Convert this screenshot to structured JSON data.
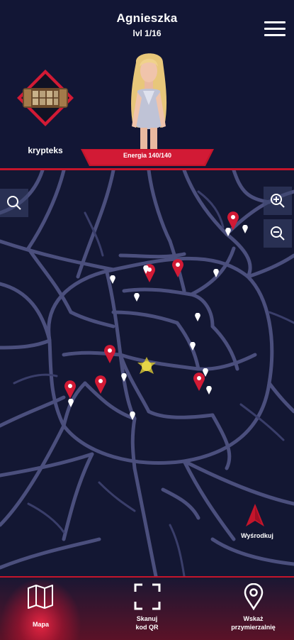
{
  "player": {
    "name": "Agnieszka",
    "level": "lvl 1/16",
    "energy": "Energia 140/140"
  },
  "item": {
    "label": "krypteks"
  },
  "map": {
    "center_label": "Wyśrodkuj"
  },
  "bottom_nav": {
    "items": [
      {
        "label": "Mapa",
        "icon": "map-icon",
        "active": true
      },
      {
        "label_line1": "Skanuj",
        "label_line2": "kod QR",
        "icon": "qr-scan-icon"
      },
      {
        "label_line1": "Wskaż",
        "label_line2": "przymierzalnię",
        "icon": "location-pin-icon"
      }
    ]
  },
  "colors": {
    "accent": "#c4152b",
    "background": "#131733",
    "road": "#4b4f7d",
    "pin": "#d21a35"
  }
}
